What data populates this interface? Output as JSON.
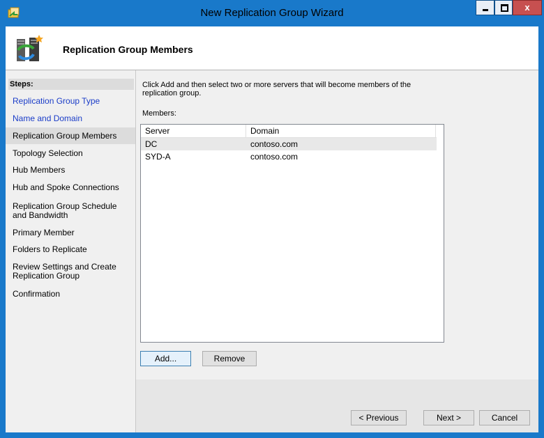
{
  "window": {
    "title": "New Replication Group Wizard",
    "close_glyph": "x",
    "app_icon": "replication-wizard-icon",
    "accent_color": "#1979ca"
  },
  "header": {
    "title": "Replication Group Members",
    "icon": "server-replication-icon"
  },
  "steps": {
    "title": "Steps:",
    "items": [
      {
        "label": "Replication Group Type",
        "state": "link"
      },
      {
        "label": "Name and Domain",
        "state": "link"
      },
      {
        "label": "Replication Group Members",
        "state": "current"
      },
      {
        "label": "Topology Selection",
        "state": "pending"
      },
      {
        "label": "Hub Members",
        "state": "pending"
      },
      {
        "label": "Hub and Spoke Connections",
        "state": "pending"
      },
      {
        "label": "Replication Group Schedule and Bandwidth",
        "state": "pending"
      },
      {
        "label": "Primary Member",
        "state": "pending"
      },
      {
        "label": "Folders to Replicate",
        "state": "pending"
      },
      {
        "label": "Review Settings and Create Replication Group",
        "state": "pending"
      },
      {
        "label": "Confirmation",
        "state": "pending"
      }
    ]
  },
  "content": {
    "instructions": "Click Add and then select two or more servers that will become members of the replication group.",
    "members_label": "Members:",
    "columns": [
      "Server",
      "Domain"
    ],
    "rows": [
      {
        "server": "DC",
        "domain": "contoso.com",
        "selected": true
      },
      {
        "server": "SYD-A",
        "domain": "contoso.com",
        "selected": false
      }
    ],
    "add_label": "Add...",
    "remove_label": "Remove"
  },
  "footer": {
    "previous_label": "< Previous",
    "next_label": "Next >",
    "cancel_label": "Cancel"
  }
}
